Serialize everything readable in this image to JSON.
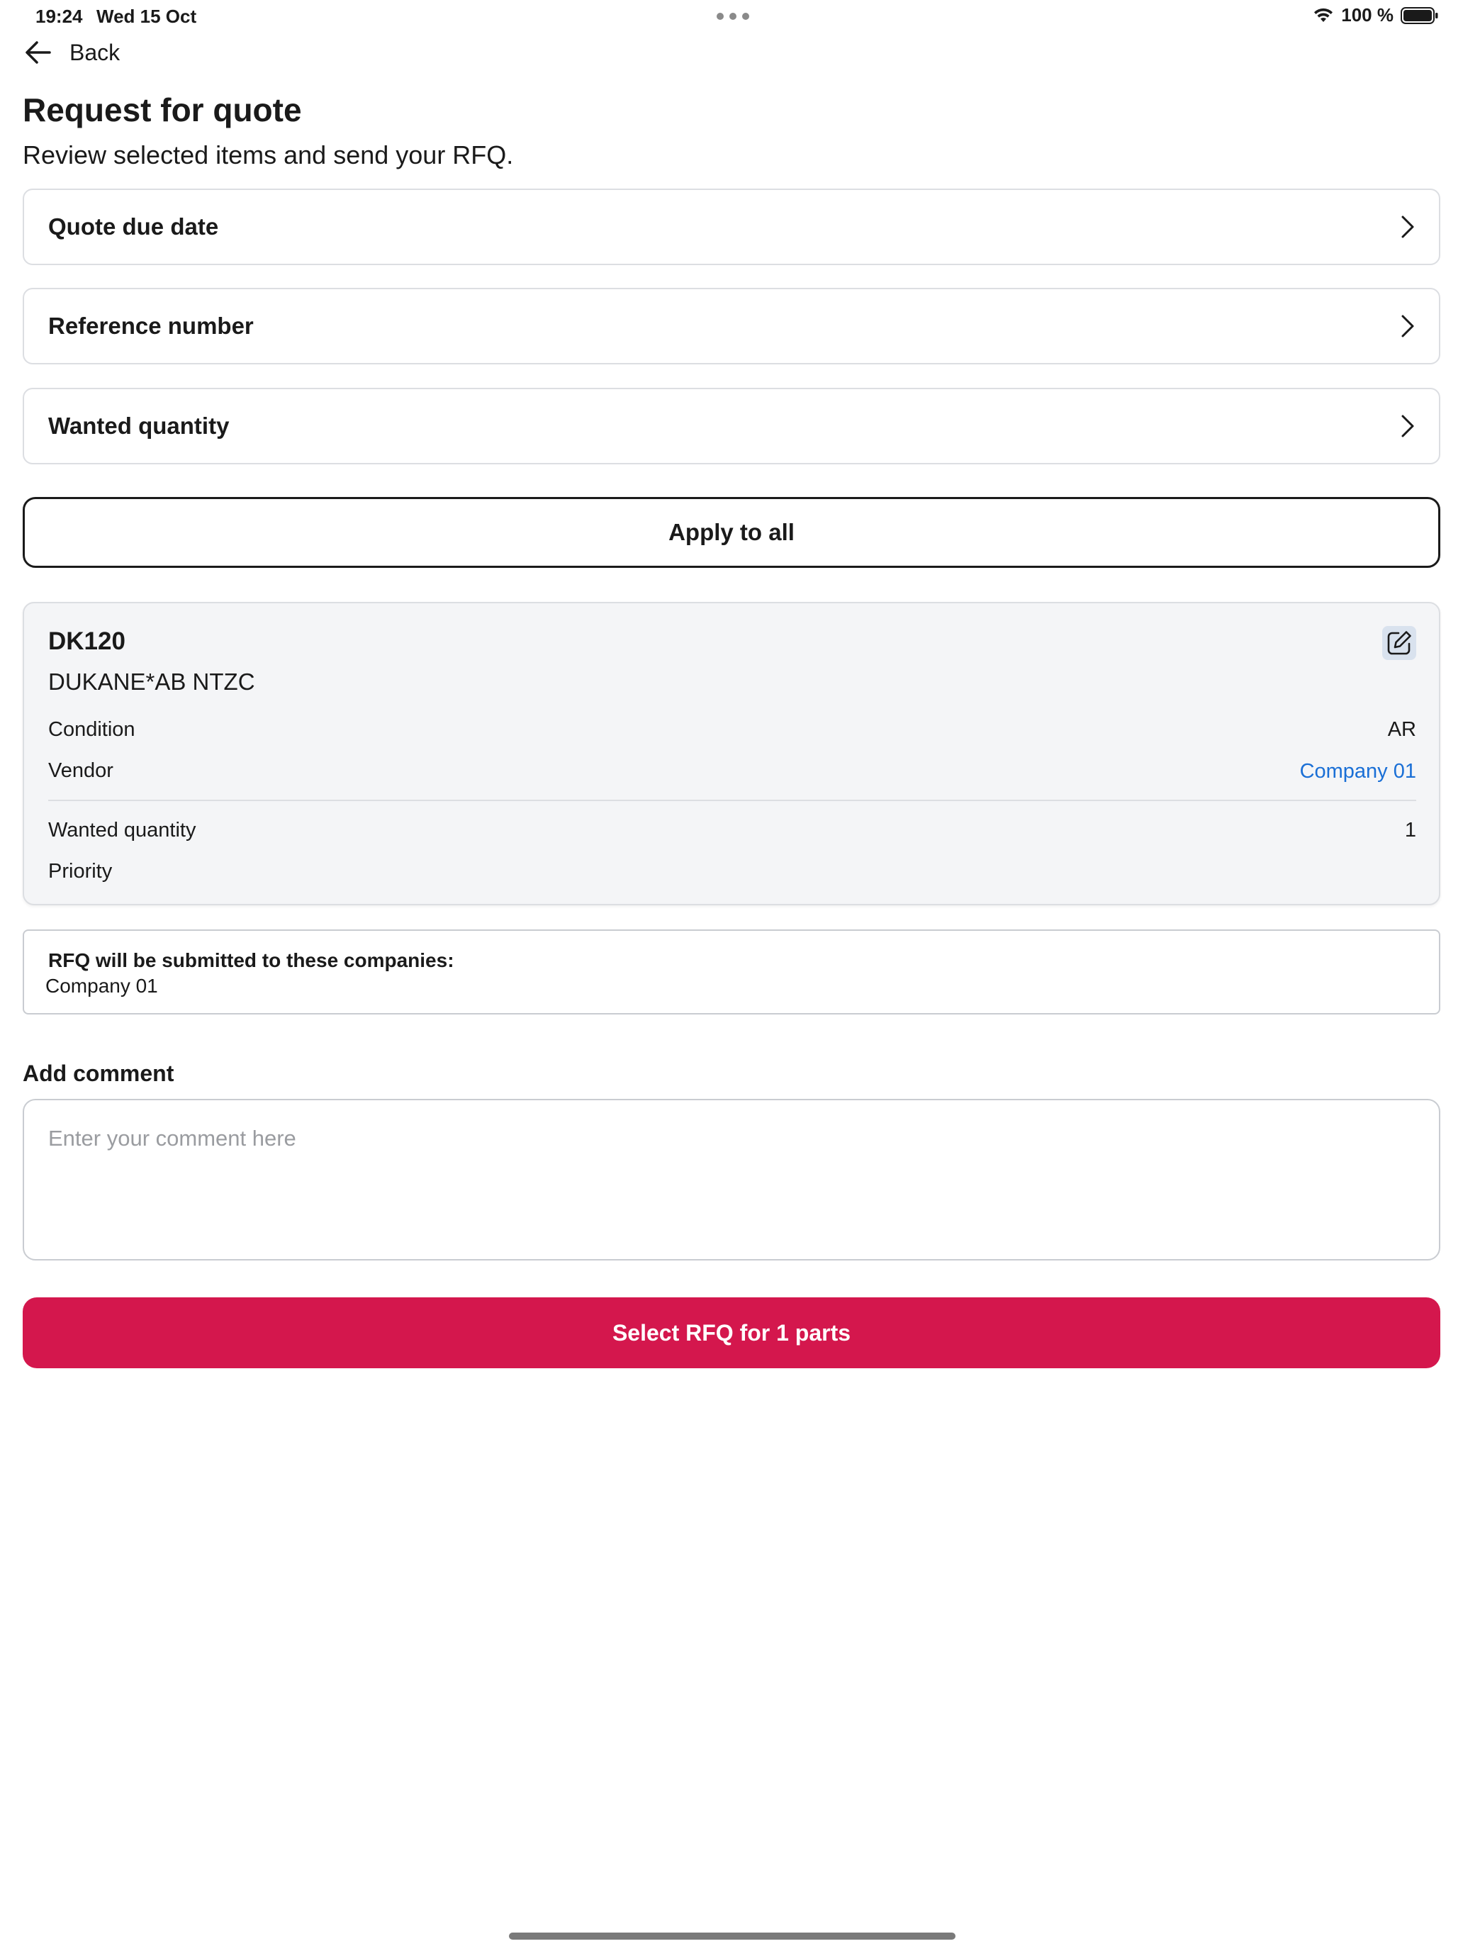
{
  "status_bar": {
    "time": "19:24",
    "date": "Wed 15 Oct",
    "battery": "100 %"
  },
  "nav": {
    "back_label": "Back"
  },
  "header": {
    "title": "Request for quote",
    "subtitle": "Review selected items and send your RFQ."
  },
  "options": [
    {
      "label": "Quote due date"
    },
    {
      "label": "Reference number"
    },
    {
      "label": "Wanted quantity"
    }
  ],
  "apply_button": {
    "label": "Apply to all"
  },
  "part": {
    "number": "DK120",
    "description": "DUKANE*AB NTZC",
    "condition_label": "Condition",
    "condition_value": "AR",
    "vendor_label": "Vendor",
    "vendor_value": "Company 01",
    "quantity_label": "Wanted quantity",
    "quantity_value": "1",
    "priority_label": "Priority",
    "priority_value": ""
  },
  "companies": {
    "title": "RFQ will be submitted to these companies:",
    "list": "Company 01"
  },
  "comment": {
    "label": "Add comment",
    "placeholder": "Enter your comment here",
    "value": ""
  },
  "submit_button": {
    "label": "Select RFQ for 1 parts"
  },
  "colors": {
    "accent": "#d4174d",
    "link": "#1a6fd6",
    "card_bg": "#f4f5f7",
    "border": "#dcdee2"
  }
}
